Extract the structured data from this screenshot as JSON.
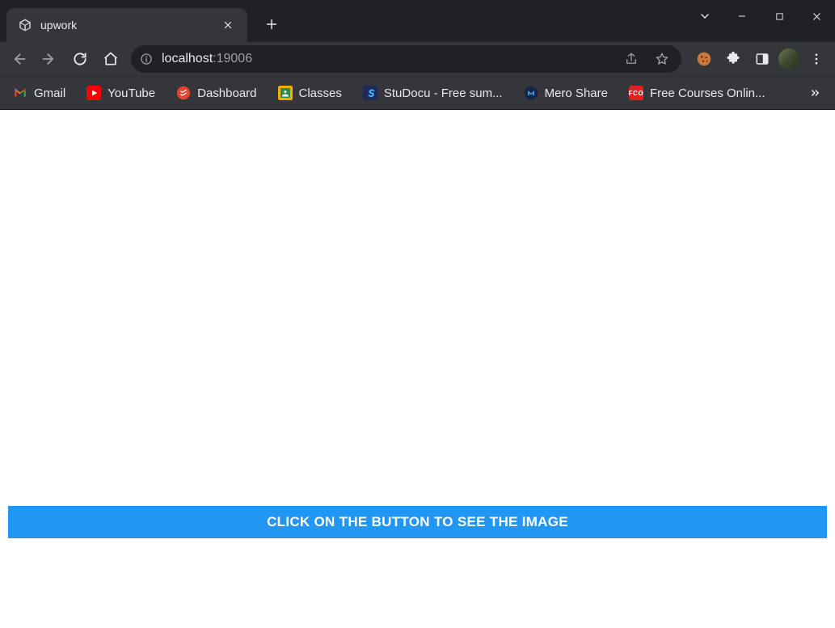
{
  "tab": {
    "title": "upwork"
  },
  "omnibox": {
    "host": "localhost",
    "port": ":19006"
  },
  "bookmarks": {
    "items": [
      {
        "label": "Gmail"
      },
      {
        "label": "YouTube"
      },
      {
        "label": "Dashboard"
      },
      {
        "label": "Classes"
      },
      {
        "label": "StuDocu - Free sum..."
      },
      {
        "label": "Mero Share"
      },
      {
        "label": "Free Courses Onlin..."
      }
    ],
    "fco_badge": "FCO"
  },
  "page": {
    "button_label": "CLICK ON THE BUTTON TO SEE THE IMAGE"
  }
}
